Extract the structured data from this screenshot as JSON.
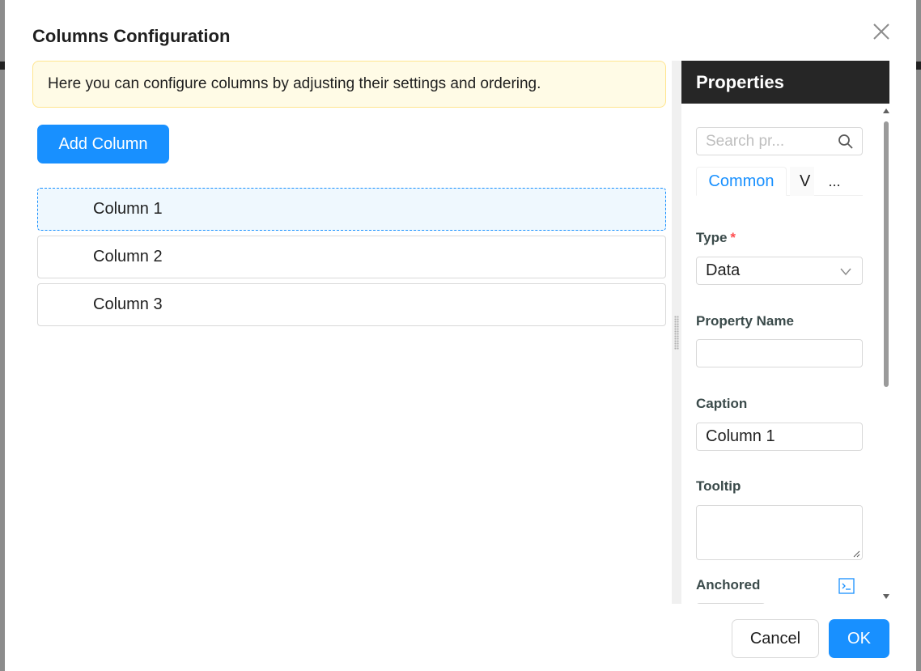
{
  "dialog": {
    "title": "Columns Configuration",
    "info_text": "Here you can configure columns by adjusting their settings and ordering.",
    "add_button_label": "Add Column",
    "columns": [
      {
        "label": "Column 1",
        "selected": true
      },
      {
        "label": "Column 2",
        "selected": false
      },
      {
        "label": "Column 3",
        "selected": false
      }
    ],
    "cancel_label": "Cancel",
    "ok_label": "OK"
  },
  "properties": {
    "header": "Properties",
    "search_placeholder": "Search pr...",
    "tabs": [
      "Common",
      "V",
      "..."
    ],
    "active_tab": "Common",
    "fields": {
      "type_label": "Type",
      "type_required_mark": "*",
      "type_value": "Data",
      "property_name_label": "Property Name",
      "property_name_value": "",
      "caption_label": "Caption",
      "caption_value": "Column 1",
      "tooltip_label": "Tooltip",
      "tooltip_value": "",
      "anchored_label": "Anchored"
    }
  },
  "colors": {
    "primary": "#1890ff",
    "info_bg": "#fffbe6",
    "info_border": "#ffe58f",
    "header_bg": "#262626",
    "required": "#ff4d4f",
    "selected_row_bg": "#eff8fe"
  },
  "icons": {
    "close": "close-icon",
    "search": "search-icon",
    "select_arrow": "chevron-down-icon",
    "code_editor": "code-editor-icon",
    "resize": "resize-handle-icon"
  }
}
